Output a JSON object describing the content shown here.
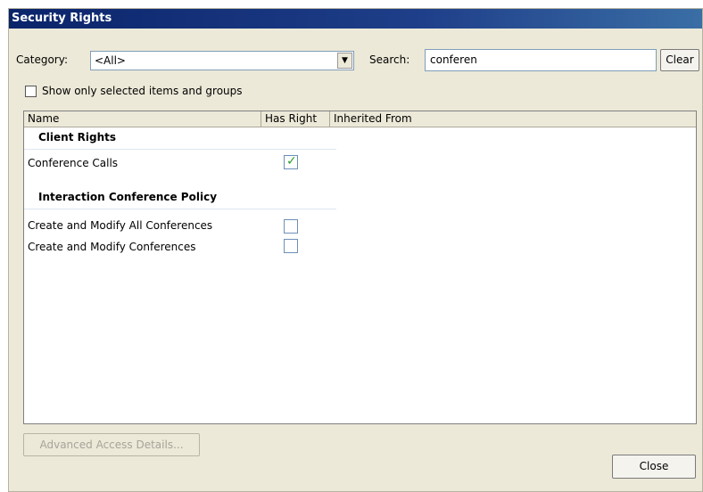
{
  "window": {
    "title": "Security Rights"
  },
  "filters": {
    "category_label": "Category:",
    "category_value": "<All>",
    "search_label": "Search:",
    "search_value": "conferen",
    "clear_label": "Clear",
    "show_selected_label": "Show only selected items and groups",
    "show_selected_checked": false
  },
  "grid": {
    "columns": [
      "Name",
      "Has Right",
      "Inherited From"
    ],
    "groups": [
      {
        "title": "Client Rights",
        "rows": [
          {
            "name": "Conference Calls",
            "has_right": true,
            "inherited_from": ""
          }
        ]
      },
      {
        "title": "Interaction Conference Policy",
        "rows": [
          {
            "name": "Create and Modify All Conferences",
            "has_right": false,
            "inherited_from": ""
          },
          {
            "name": "Create and Modify Conferences",
            "has_right": false,
            "inherited_from": ""
          }
        ]
      }
    ]
  },
  "footer": {
    "advanced_label": "Advanced Access Details...",
    "close_label": "Close"
  },
  "colors": {
    "titlebar": "#0a246a",
    "check": "#2a9e2a",
    "dialog_bg": "#ece9d8"
  }
}
